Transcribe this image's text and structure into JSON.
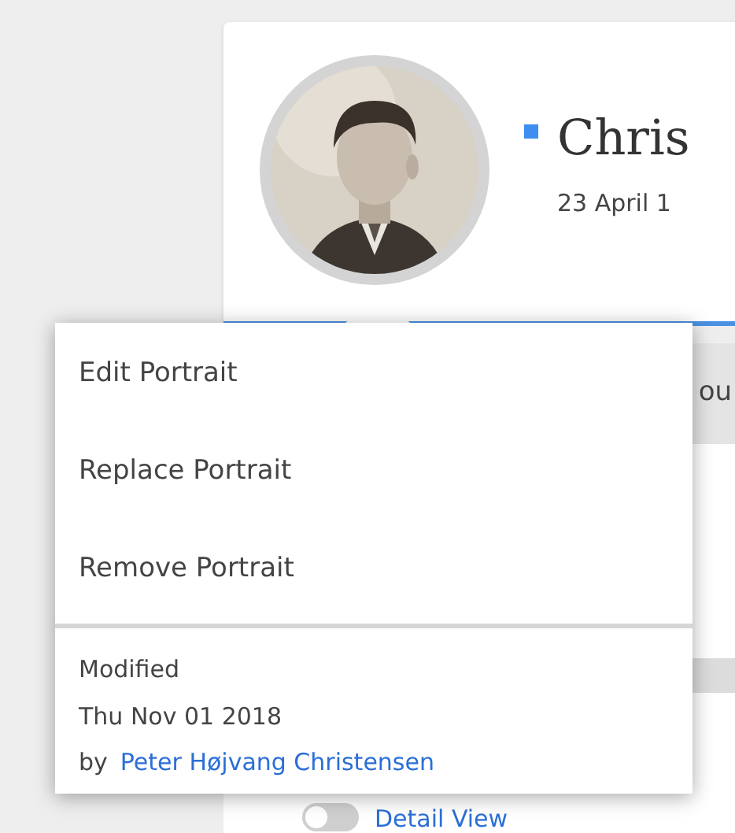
{
  "profile": {
    "name": "Chris",
    "date": "23 April 1"
  },
  "tab_fragment": "ou",
  "detail_toggle": {
    "label": "Detail View",
    "on": false
  },
  "portrait_menu": {
    "items": [
      {
        "label": "Edit Portrait"
      },
      {
        "label": "Replace Portrait"
      },
      {
        "label": "Remove Portrait"
      }
    ],
    "modified": {
      "label": "Modified",
      "date": "Thu Nov 01 2018",
      "by": "by",
      "author": "Peter Højvang Christensen"
    }
  }
}
